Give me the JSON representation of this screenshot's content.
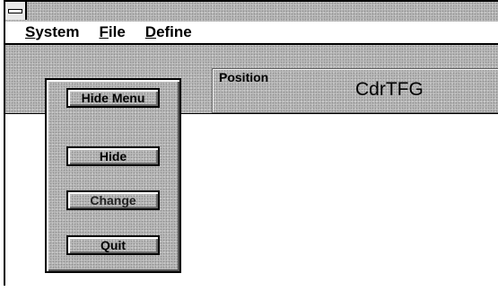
{
  "menu": {
    "items": [
      {
        "mnemonic": "S",
        "rest": "ystem"
      },
      {
        "mnemonic": "F",
        "rest": "ile"
      },
      {
        "mnemonic": "D",
        "rest": "efine"
      }
    ]
  },
  "position": {
    "label": "Position",
    "value": "CdrTFG"
  },
  "panel": {
    "buttons": {
      "hide_menu": "Hide Menu",
      "hide": "Hide",
      "change": "Change",
      "quit": "Quit"
    }
  }
}
